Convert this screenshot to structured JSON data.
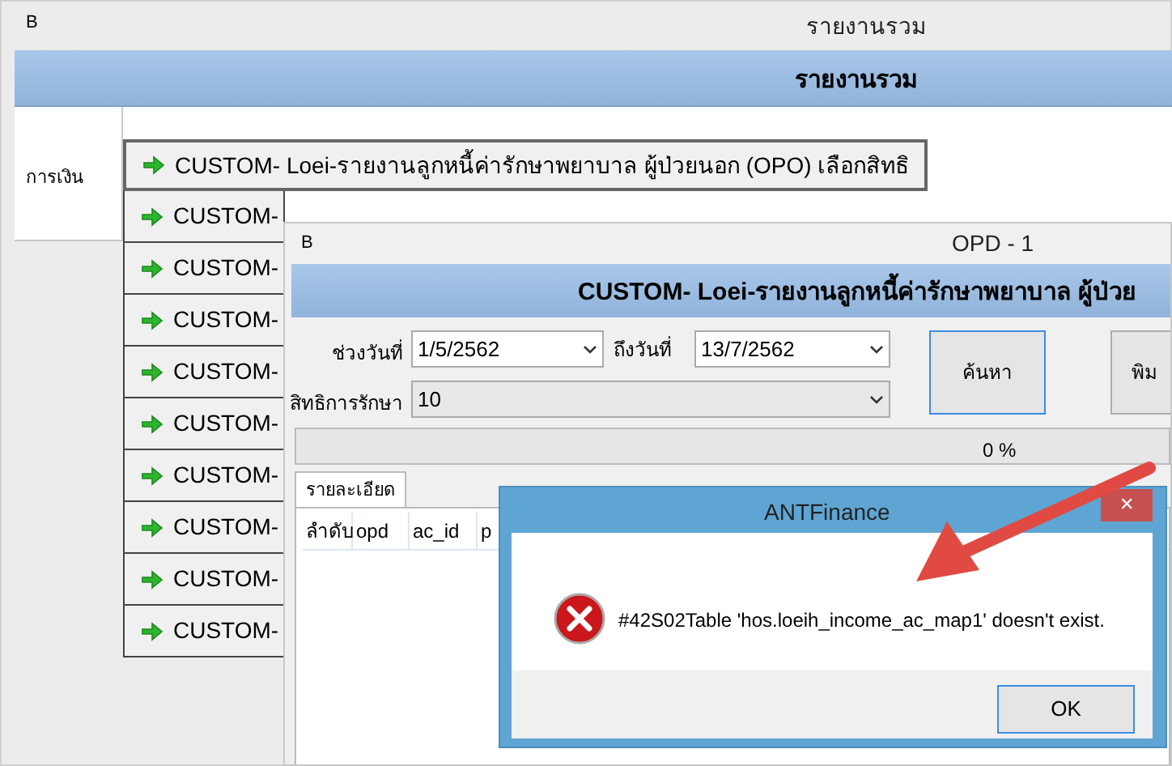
{
  "main_window": {
    "icon_text": "B",
    "title": "รายงานรวม",
    "header": "รายงานรวม",
    "category": "การเงิน",
    "reports": [
      {
        "label": "CUSTOM- Loei-รายงานลูกหนี้ค่ารักษาพยาบาล ผู้ป่วยนอก (OPO) เลือกสิทธิ",
        "selected": true
      },
      {
        "label": "CUSTOM-",
        "selected": false
      },
      {
        "label": "CUSTOM-",
        "selected": false
      },
      {
        "label": "CUSTOM-",
        "selected": false
      },
      {
        "label": "CUSTOM-",
        "selected": false
      },
      {
        "label": "CUSTOM-",
        "selected": false
      },
      {
        "label": "CUSTOM-",
        "selected": false
      },
      {
        "label": "CUSTOM-",
        "selected": false
      },
      {
        "label": "CUSTOM-",
        "selected": false
      },
      {
        "label": "CUSTOM-",
        "selected": false
      }
    ]
  },
  "report_window": {
    "icon_text": "B",
    "title": "OPD - 1",
    "header": "CUSTOM- Loei-รายงานลูกหนี้ค่ารักษาพยาบาล ผู้ป่วย",
    "from_label": "ช่วงวันที่",
    "from_value": "1/5/2562",
    "to_label": "ถึงวันที่",
    "to_value": "13/7/2562",
    "rights_label": "สิทธิการรักษา",
    "rights_value": "10",
    "buttons": [
      {
        "label": "ค้นหา",
        "focused": true
      },
      {
        "label": "พิม",
        "focused": false
      }
    ],
    "progress": {
      "level": 0,
      "text": "0 %"
    },
    "tabs": [
      {
        "label": "รายละเอียด",
        "selected": true
      }
    ],
    "table": {
      "columns": [
        "ลำดับ",
        "opd",
        "ac_id",
        "p"
      ]
    }
  },
  "dialog": {
    "title": "ANTFinance",
    "close": "✕",
    "message": "#42S02Table 'hos.loeih_income_ac_map1' doesn't exist.",
    "button": "OK"
  }
}
